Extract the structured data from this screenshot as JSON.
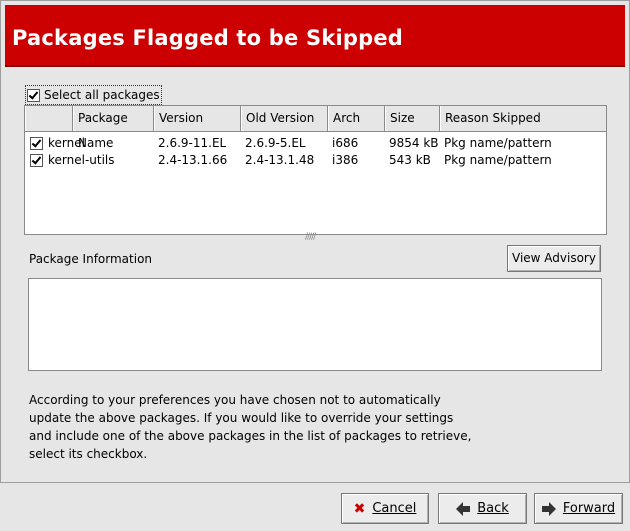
{
  "banner": {
    "title": "Packages Flagged to be Skipped",
    "color": "#cc0000"
  },
  "select_all": {
    "label": "Select all packages",
    "checked": true
  },
  "table": {
    "columns": [
      "Package Name",
      "Version",
      "Old Version",
      "Arch",
      "Size",
      "Reason Skipped"
    ],
    "rows": [
      {
        "checked": true,
        "name": "kernel",
        "version": "2.6.9-11.EL",
        "old_version": "2.6.9-5.EL",
        "arch": "i686",
        "size": "9854 kB",
        "reason": "Pkg name/pattern"
      },
      {
        "checked": true,
        "name": "kernel-utils",
        "version": "2.4-13.1.66",
        "old_version": "2.4-13.1.48",
        "arch": "i386",
        "size": "543 kB",
        "reason": "Pkg name/pattern"
      }
    ]
  },
  "package_info": {
    "label": "Package Information",
    "view_advisory": "View Advisory",
    "content": ""
  },
  "description": [
    "According to your preferences you have chosen not to automatically",
    "update the above packages.  If you would like to override your settings",
    "and include one of the above packages in the list of packages to retrieve,",
    "select its checkbox."
  ],
  "buttons": {
    "cancel": {
      "label": "Cancel",
      "icon": "close-icon"
    },
    "back": {
      "label": "Back",
      "icon": "back-arrow-icon"
    },
    "forward": {
      "label": "Forward",
      "icon": "forward-arrow-icon"
    }
  }
}
